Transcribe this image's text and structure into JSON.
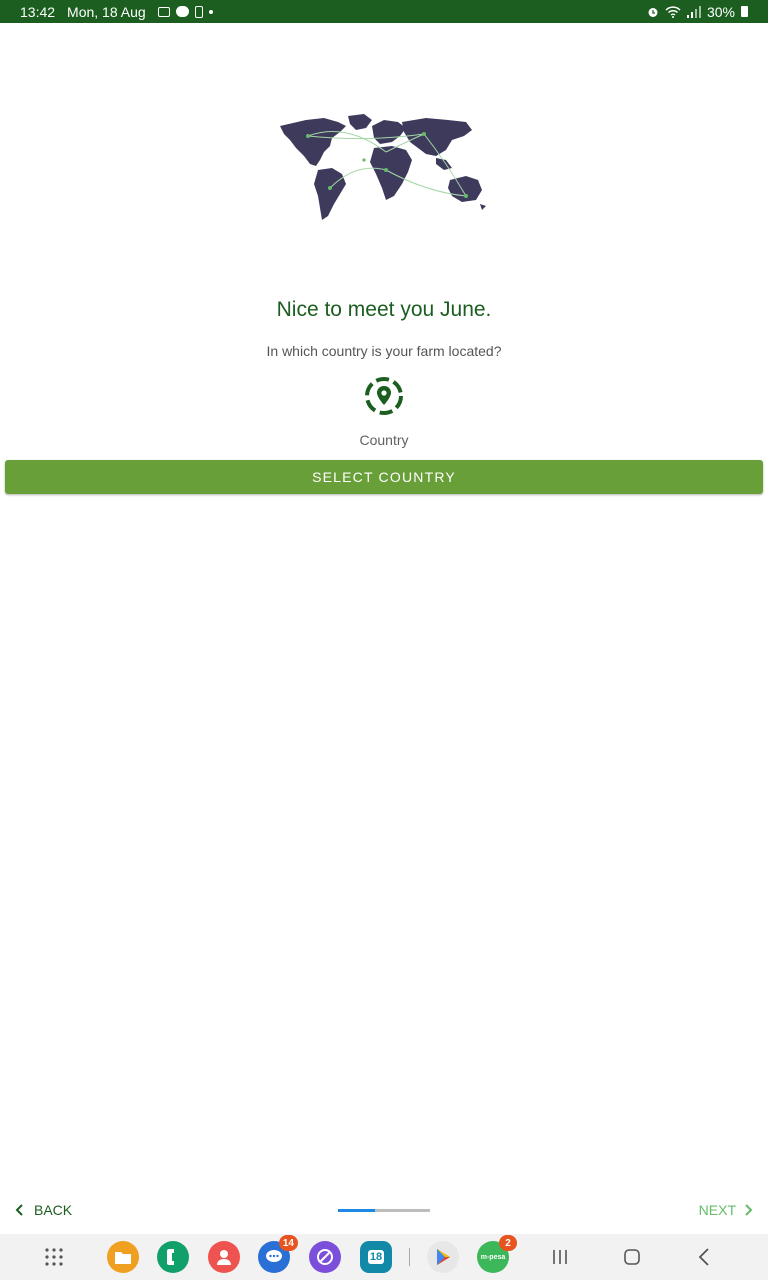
{
  "status_bar": {
    "time": "13:42",
    "date": "Mon, 18 Aug",
    "battery": "30%",
    "icons": [
      "gallery-icon",
      "chat-icon",
      "sim-icon",
      "dot-icon",
      "alarm-icon",
      "wifi-icon",
      "signal-icon",
      "battery-icon"
    ]
  },
  "onboarding": {
    "greeting": "Nice to meet you June.",
    "question": "In which country is your farm located?",
    "country_label": "Country",
    "select_button": "SELECT COUNTRY",
    "illustration": "world-map-icon",
    "location_icon": "location-pin-icon"
  },
  "navigation": {
    "back_label": "BACK",
    "next_label": "NEXT",
    "progress": 0.4
  },
  "system_bar": {
    "apps": [
      {
        "name": "app-drawer-icon"
      },
      {
        "name": "files-icon",
        "color": "#f0a020"
      },
      {
        "name": "phone-icon",
        "color": "#11a06a"
      },
      {
        "name": "contacts-icon",
        "color": "#ef5350"
      },
      {
        "name": "messages-icon",
        "color": "#2a6fd6",
        "badge": "14"
      },
      {
        "name": "browser-icon",
        "color": "#7b4fd9"
      },
      {
        "name": "calendar-icon",
        "color": "#1289a7",
        "label": "18"
      },
      {
        "name": "play-store-icon"
      },
      {
        "name": "mpesa-icon",
        "color": "#3cb75a",
        "badge": "2",
        "label": "m-pesa"
      }
    ],
    "nav": [
      "recents-icon",
      "home-icon",
      "back-nav-icon"
    ]
  },
  "colors": {
    "status_bar": "#1b5e20",
    "primary_text": "#1b5e20",
    "button": "#689f38",
    "next": "#66bb6a",
    "progress_fill": "#1e88e5"
  }
}
